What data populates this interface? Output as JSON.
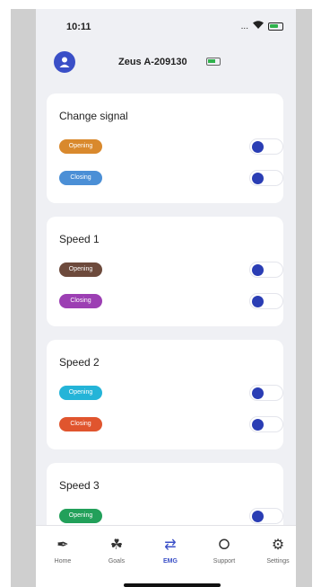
{
  "status_bar": {
    "time": "10:11",
    "signal_text": "...",
    "wifi_icon": "wifi-icon",
    "battery_icon": "battery-icon"
  },
  "header": {
    "device_name": "Zeus A-209130",
    "avatar_icon": "user-icon"
  },
  "colors": {
    "accent": "#3a4fc7",
    "toggle_knob": "#2a3db4",
    "background": "#eff0f4"
  },
  "sections": [
    {
      "title": "Change signal",
      "rows": [
        {
          "label": "Opening",
          "color": "#d9892d",
          "enabled": false
        },
        {
          "label": "Closing",
          "color": "#4b8fd6",
          "enabled": false
        }
      ]
    },
    {
      "title": "Speed 1",
      "rows": [
        {
          "label": "Opening",
          "color": "#6d4a3c",
          "enabled": false
        },
        {
          "label": "Closing",
          "color": "#9c3fb3",
          "enabled": false
        }
      ]
    },
    {
      "title": "Speed 2",
      "rows": [
        {
          "label": "Opening",
          "color": "#24b4d8",
          "enabled": false
        },
        {
          "label": "Closing",
          "color": "#e0552e",
          "enabled": false
        }
      ]
    },
    {
      "title": "Speed 3",
      "rows": [
        {
          "label": "Opening",
          "color": "#22a05a",
          "enabled": false
        }
      ]
    }
  ],
  "tabs": [
    {
      "label": "Home",
      "icon": "home-icon",
      "glyph": "✒",
      "active": false
    },
    {
      "label": "Goals",
      "icon": "goals-icon",
      "glyph": "☘",
      "active": false
    },
    {
      "label": "EMG",
      "icon": "sliders-icon",
      "glyph": "⇄",
      "active": true
    },
    {
      "label": "Support",
      "icon": "support-icon",
      "glyph": "⭘",
      "active": false
    },
    {
      "label": "Settings",
      "icon": "gear-icon",
      "glyph": "⚙",
      "active": false
    }
  ]
}
